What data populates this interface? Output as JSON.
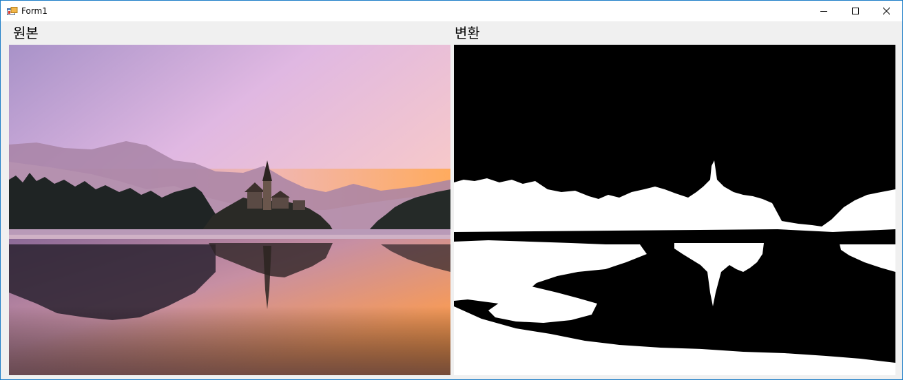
{
  "window": {
    "title": "Form1",
    "controls": [
      "minimize-icon",
      "maximize-icon",
      "close-icon"
    ]
  },
  "panels": [
    {
      "label": "원본",
      "image": "lake-bled-sunrise-photo"
    },
    {
      "label": "변환",
      "image": "binary-threshold-photo"
    }
  ],
  "colors": {
    "window_border": "#1a7cc7",
    "form_background": "#f0f0f0"
  }
}
